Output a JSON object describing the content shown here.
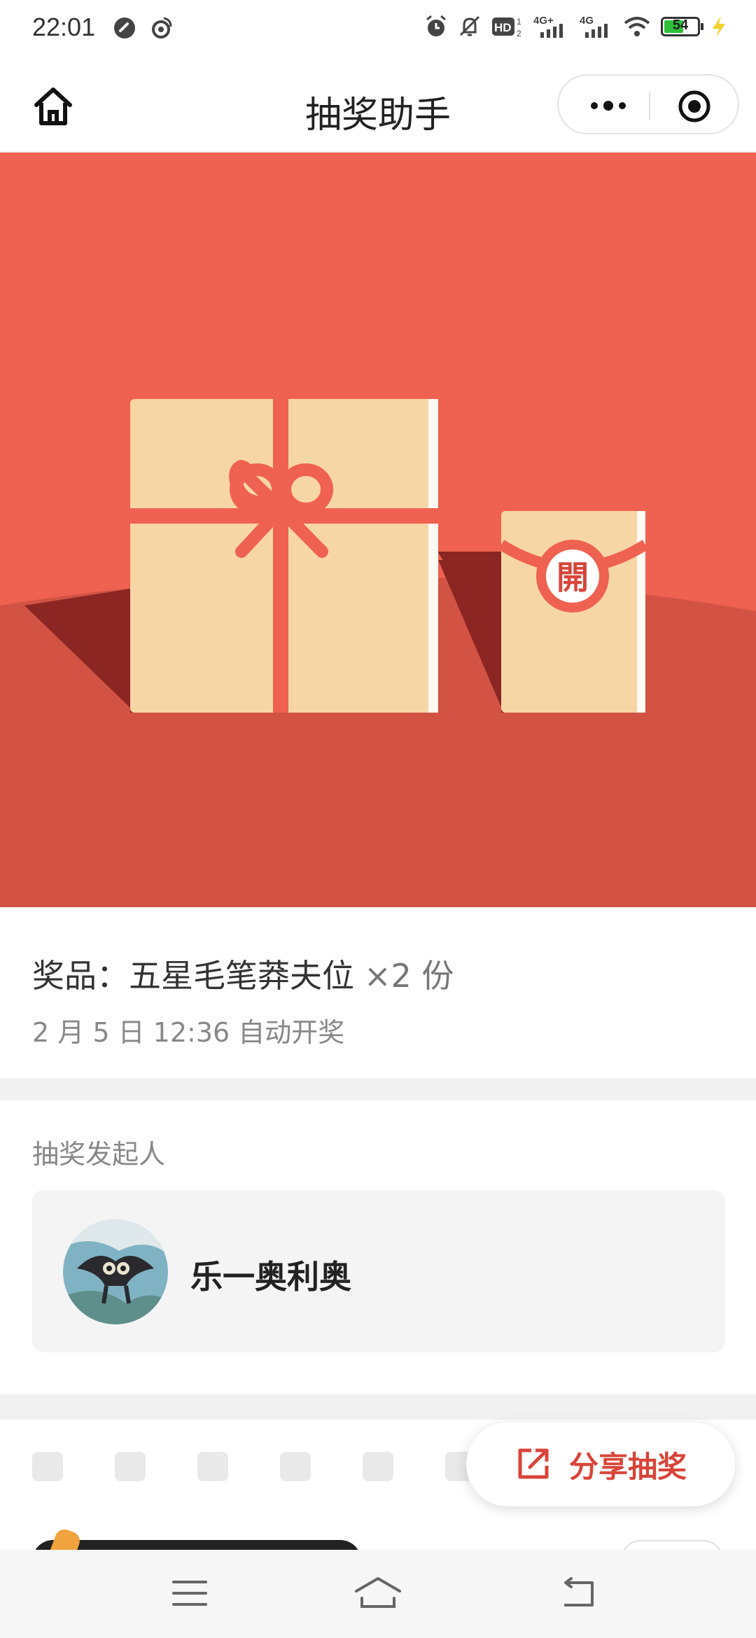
{
  "status_bar": {
    "time": "22:01",
    "battery_level": "54",
    "network_labels": [
      "4G+",
      "4G"
    ],
    "hd_label": "HD"
  },
  "title_bar": {
    "title": "抽奖助手",
    "icons": [
      "home-icon",
      "more-icon",
      "target-icon"
    ]
  },
  "banner": {
    "seal_text": "開",
    "colors": {
      "sky": "#ef6150",
      "ground": "#d25344",
      "box": "#f7d6a5",
      "ribbon": "#ef6150",
      "shadow": "#8b2623"
    }
  },
  "prize": {
    "label": "奖品：五星毛笔莽夫位",
    "count": "×2 份",
    "draw_time": "2 月 5 日 12:36 自动开奖"
  },
  "initiator": {
    "label": "抽奖发起人",
    "name": "乐一奥利奥"
  },
  "share": {
    "label": "分享抽奖",
    "icon": "share-icon",
    "color": "#d9453a"
  },
  "nav": {
    "icons": [
      "menu-icon",
      "home-icon",
      "back-icon"
    ]
  }
}
